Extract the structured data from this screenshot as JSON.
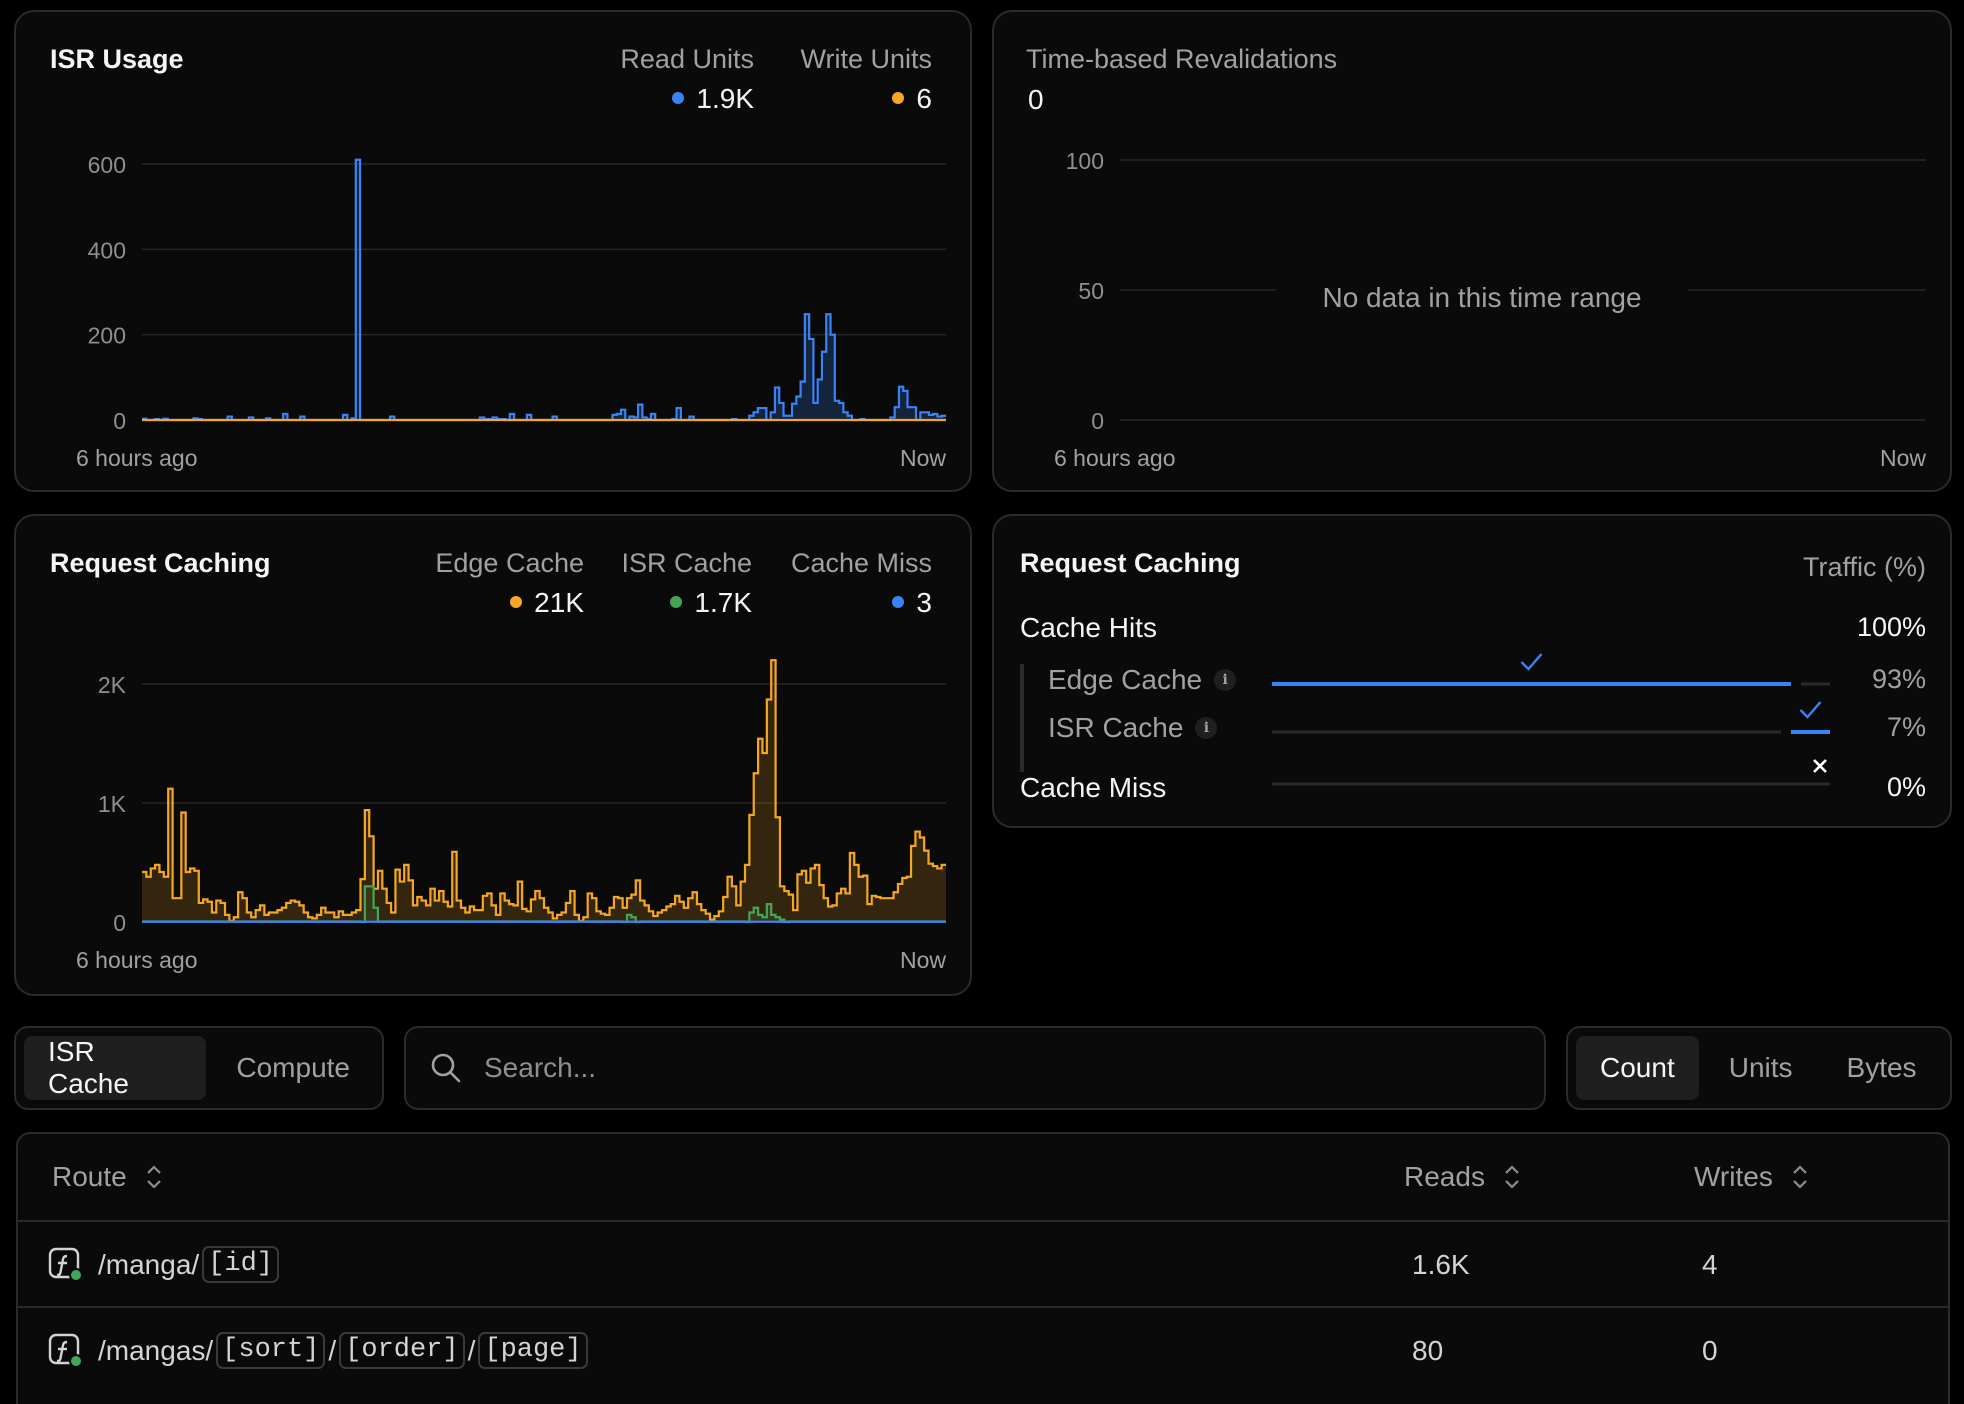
{
  "isr_usage": {
    "title": "ISR Usage",
    "legend": [
      {
        "label": "Read Units",
        "value": "1.9K",
        "color": "#3b82f6"
      },
      {
        "label": "Write Units",
        "value": "6",
        "color": "#f5a623"
      }
    ],
    "x_start": "6 hours ago",
    "x_end": "Now"
  },
  "time_revalidations": {
    "title": "Time-based Revalidations",
    "value": "0",
    "empty_message": "No data in this time range",
    "x_start": "6 hours ago",
    "x_end": "Now"
  },
  "request_caching_chart": {
    "title": "Request Caching",
    "legend": [
      {
        "label": "Edge Cache",
        "value": "21K",
        "color": "#f5a623"
      },
      {
        "label": "ISR Cache",
        "value": "1.7K",
        "color": "#45a557"
      },
      {
        "label": "Cache Miss",
        "value": "3",
        "color": "#3b82f6"
      }
    ],
    "x_start": "6 hours ago",
    "x_end": "Now"
  },
  "request_caching_breakdown": {
    "title": "Request Caching",
    "header_right": "Traffic (%)",
    "cache_hits_label": "Cache Hits",
    "cache_hits_pct": "100%",
    "rows": [
      {
        "label": "Edge Cache",
        "pct": "93%",
        "fraction": 0.93,
        "icon": "info-icon"
      },
      {
        "label": "ISR Cache",
        "pct": "7%",
        "fraction": 0.07,
        "icon": "info-icon"
      }
    ],
    "cache_miss_label": "Cache Miss",
    "cache_miss_pct": "0%",
    "cache_miss_fraction": 0.0,
    "colors": {
      "bar": "#3b82f6",
      "track": "#2a2a2a"
    }
  },
  "controls": {
    "source_tabs": [
      "ISR Cache",
      "Compute"
    ],
    "source_active": "ISR Cache",
    "search_placeholder": "Search...",
    "metric_tabs": [
      "Count",
      "Units",
      "Bytes"
    ],
    "metric_active": "Count"
  },
  "table": {
    "columns": {
      "route": "Route",
      "reads": "Reads",
      "writes": "Writes"
    },
    "rows": [
      {
        "route_parts": [
          "/manga/",
          "[id]"
        ],
        "reads": "1.6K",
        "writes": "4"
      },
      {
        "route_parts": [
          "/mangas/",
          "[sort]",
          "/",
          "[order]",
          "/",
          "[page]"
        ],
        "reads": "80",
        "writes": "0"
      }
    ]
  },
  "chart_data": [
    {
      "type": "area",
      "title": "ISR Usage",
      "xlabel": "",
      "ylabel": "",
      "ylim": [
        0,
        600
      ],
      "yticks": [
        0,
        200,
        400,
        600
      ],
      "x_range_labels": [
        "6 hours ago",
        "Now"
      ],
      "grid": true,
      "series": [
        {
          "name": "Read Units",
          "color": "#3b82f6",
          "values": [
            3,
            0,
            0,
            2,
            0,
            3,
            0,
            0,
            0,
            0,
            0,
            0,
            4,
            2,
            0,
            0,
            0,
            0,
            0,
            0,
            8,
            0,
            0,
            0,
            0,
            6,
            0,
            0,
            0,
            4,
            0,
            0,
            0,
            14,
            0,
            0,
            0,
            8,
            0,
            0,
            0,
            0,
            0,
            0,
            0,
            0,
            0,
            12,
            0,
            4,
            6,
            0,
            0,
            0,
            0,
            0,
            0,
            0,
            8,
            0,
            0,
            0,
            0,
            0,
            0,
            0,
            0,
            0,
            0,
            0,
            0,
            0,
            0,
            0,
            0,
            0,
            0,
            0,
            0,
            6,
            2,
            2,
            6,
            2,
            2,
            0,
            14,
            0,
            0,
            0,
            12,
            0,
            0,
            0,
            0,
            0,
            8,
            0,
            0,
            0,
            0,
            0,
            0,
            0,
            0,
            0,
            0,
            0,
            0,
            0,
            12,
            14,
            24,
            0,
            8,
            6,
            36,
            6,
            2,
            14,
            0,
            0,
            0,
            0,
            2,
            28,
            0,
            0,
            8,
            0,
            0,
            0,
            0,
            0,
            0,
            0,
            0,
            0,
            2,
            0,
            0,
            0,
            10,
            18,
            28,
            28,
            0,
            18,
            76,
            40,
            10,
            10,
            38,
            55,
            90,
            248,
            190,
            40,
            95,
            160,
            248,
            200,
            45,
            40,
            18,
            10,
            0,
            0,
            2,
            0,
            0,
            0,
            0,
            0,
            0,
            6,
            30,
            78,
            68,
            30,
            30,
            0,
            18,
            18,
            12,
            14,
            8,
            10
          ]
        },
        {
          "name": "Write Units",
          "color": "#f5a623",
          "values": [
            0,
            0,
            0,
            0,
            0,
            0,
            0,
            0,
            0,
            0,
            0,
            0,
            0,
            0,
            0,
            0,
            0,
            0,
            0,
            0,
            0,
            0,
            0,
            0,
            0,
            0,
            0,
            0,
            0,
            0,
            0,
            0,
            0,
            0,
            0,
            0,
            0,
            0,
            0,
            0,
            0,
            0,
            0,
            0,
            0,
            0,
            0,
            0,
            0,
            0,
            0,
            0,
            0,
            0,
            0,
            0,
            0,
            0,
            0,
            0,
            0,
            0,
            0,
            0,
            0,
            0,
            0,
            0,
            0,
            0,
            0,
            0,
            0,
            0,
            0,
            0,
            0,
            0,
            0,
            0,
            0,
            0,
            0,
            0,
            0,
            0,
            0,
            0,
            0,
            0,
            0,
            0,
            0,
            0,
            0,
            0,
            0,
            0,
            0,
            0,
            0,
            0,
            0,
            0,
            0,
            0,
            0,
            0,
            0,
            0,
            0,
            0,
            0,
            0,
            0,
            0,
            0,
            0,
            0,
            0,
            0,
            0,
            0,
            0,
            0,
            0,
            0,
            0,
            0,
            0,
            0,
            0,
            0,
            0,
            0,
            0,
            0,
            0,
            0,
            0,
            0,
            0,
            0,
            0,
            0,
            0,
            0,
            0,
            0,
            0,
            0,
            0,
            0,
            0,
            0,
            0,
            0,
            0,
            0,
            0,
            0,
            0,
            0,
            0,
            0,
            0,
            0,
            0,
            0,
            0,
            0,
            0,
            0,
            0,
            0,
            0,
            0,
            0,
            0,
            0,
            0,
            0,
            0,
            0,
            0,
            0,
            0,
            0,
            0,
            0
          ]
        }
      ],
      "spike": {
        "index": 50,
        "value": 610
      }
    },
    {
      "type": "line",
      "title": "Time-based Revalidations",
      "ylim": [
        0,
        100
      ],
      "yticks": [
        0,
        50,
        100
      ],
      "x_range_labels": [
        "6 hours ago",
        "Now"
      ],
      "grid": true,
      "series": []
    },
    {
      "type": "area",
      "title": "Request Caching",
      "ylim": [
        0,
        2000
      ],
      "yticks": [
        0,
        1000,
        2000
      ],
      "ytick_labels": [
        "0",
        "1K",
        "2K"
      ],
      "x_range_labels": [
        "6 hours ago",
        "Now"
      ],
      "grid": true,
      "series": [
        {
          "name": "Edge Cache",
          "color": "#f5a623",
          "values": [
            420,
            380,
            450,
            480,
            420,
            380,
            1120,
            200,
            200,
            920,
            420,
            450,
            430,
            160,
            190,
            170,
            80,
            180,
            160,
            60,
            10,
            40,
            250,
            200,
            80,
            40,
            100,
            140,
            60,
            80,
            80,
            100,
            120,
            160,
            180,
            170,
            140,
            80,
            40,
            30,
            60,
            120,
            80,
            80,
            40,
            90,
            60,
            60,
            80,
            100,
            360,
            940,
            720,
            280,
            430,
            280,
            160,
            80,
            440,
            340,
            480,
            350,
            140,
            210,
            180,
            140,
            280,
            180,
            260,
            170,
            130,
            590,
            180,
            120,
            80,
            130,
            100,
            100,
            220,
            240,
            140,
            60,
            240,
            180,
            150,
            140,
            340,
            110,
            90,
            190,
            260,
            200,
            120,
            80,
            30,
            60,
            80,
            160,
            260,
            60,
            10,
            40,
            240,
            200,
            90,
            70,
            60,
            120,
            210,
            200,
            120,
            200,
            230,
            350,
            180,
            140,
            90,
            50,
            80,
            100,
            130,
            150,
            220,
            170,
            120,
            200,
            250,
            150,
            100,
            70,
            20,
            50,
            90,
            210,
            380,
            300,
            140,
            340,
            480,
            900,
            1250,
            1540,
            1420,
            1870,
            2200,
            880,
            300,
            260,
            230,
            100,
            400,
            430,
            330,
            450,
            480,
            310,
            200,
            130,
            140,
            240,
            280,
            240,
            580,
            480,
            380,
            390,
            150,
            220,
            210,
            200,
            200,
            200,
            250,
            320,
            370,
            380,
            640,
            760,
            710,
            600,
            490,
            470,
            450,
            480
          ]
        },
        {
          "name": "ISR Cache",
          "color": "#45a557",
          "values": [
            0,
            0,
            0,
            0,
            0,
            0,
            0,
            0,
            0,
            0,
            0,
            0,
            0,
            0,
            0,
            0,
            0,
            0,
            0,
            0,
            0,
            0,
            0,
            0,
            0,
            0,
            0,
            0,
            0,
            0,
            0,
            0,
            0,
            0,
            0,
            0,
            0,
            0,
            0,
            0,
            0,
            0,
            0,
            0,
            0,
            0,
            0,
            0,
            0,
            0,
            0,
            0,
            0,
            0,
            0,
            0,
            0,
            0,
            0,
            0,
            0,
            0,
            0,
            0,
            0,
            0,
            0,
            0,
            0,
            0,
            0,
            0,
            0,
            0,
            0,
            0,
            0,
            0,
            0,
            0,
            0,
            0,
            0,
            0,
            0,
            0,
            0,
            0,
            0,
            0,
            0,
            0,
            0,
            0,
            0,
            0,
            0,
            0,
            0,
            0,
            0,
            0,
            0,
            0,
            0,
            0,
            0,
            0,
            0,
            0,
            0,
            0,
            0,
            0,
            0,
            0,
            0,
            0,
            0,
            0,
            0,
            0,
            0,
            0,
            0,
            0,
            0,
            0,
            0,
            0,
            0,
            0,
            0,
            0,
            0,
            0,
            0,
            0,
            0,
            0,
            0,
            0,
            0,
            0,
            0,
            0,
            0,
            0,
            0,
            0,
            0,
            0,
            0,
            0,
            0,
            0,
            0,
            0,
            0,
            0,
            0,
            0,
            0,
            0,
            0,
            0,
            0,
            0,
            0,
            0,
            0,
            0,
            0,
            0,
            0,
            0,
            0,
            0,
            0,
            0,
            0,
            0,
            0,
            0,
            0,
            0,
            0,
            0,
            0,
            0
          ]
        },
        {
          "name": "Cache Miss",
          "color": "#3b82f6",
          "values": []
        }
      ]
    }
  ]
}
